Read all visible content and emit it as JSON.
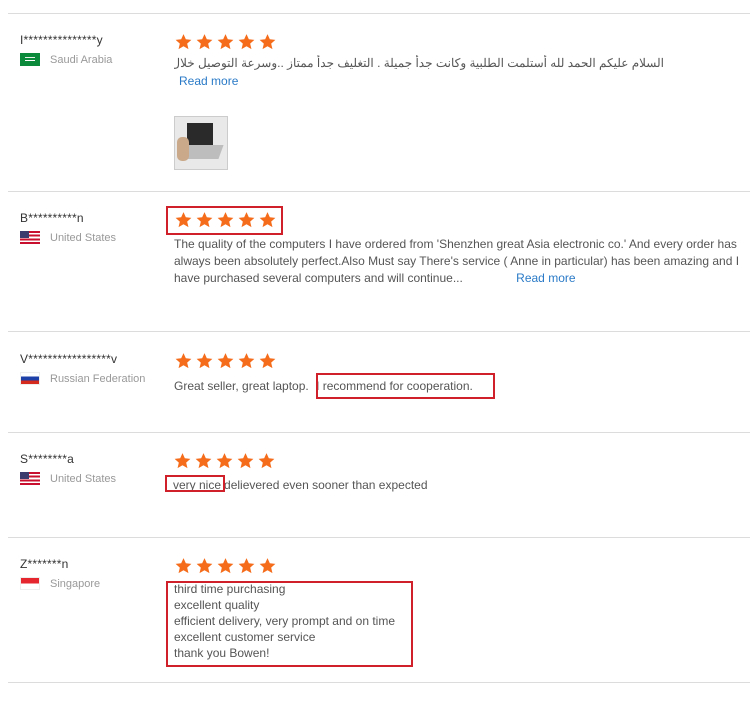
{
  "colors": {
    "star": "#f56c1b",
    "link": "#2a7ac7",
    "highlight": "#d0202a"
  },
  "reviews": [
    {
      "name": "I***************y",
      "country": "Saudi Arabia",
      "flag_icon": "saudi-arabia-flag-icon",
      "rating": 5,
      "text": "السلام عليكم الحمد لله أستلمت الطلبية وكانت جدأ جميلة . التغليف جدأ ممتاز ..وسرعة التوصيل خلال اسبوع..الجهاز ويند...",
      "read_more": "Read more",
      "has_photo": true
    },
    {
      "name": "B**********n",
      "country": "United States",
      "flag_icon": "united-states-flag-icon",
      "rating": 5,
      "text": "The quality of the computers I have ordered from 'Shenzhen great Asia electronic co.' And every order has always been absolutely perfect.Also Must say There's service ( Anne in particular) has been amazing and I have purchased several computers and will continue...",
      "read_more": "Read more"
    },
    {
      "name": "V*****************v",
      "country": "Russian Federation",
      "flag_icon": "russia-flag-icon",
      "rating": 5,
      "text_a": "Great seller, great laptop.",
      "text_b": "I recommend for cooperation."
    },
    {
      "name": "S********a",
      "country": "United States",
      "flag_icon": "united-states-flag-icon",
      "rating": 5,
      "text_a": "very nice",
      "text_b": "delievered even sooner than expected"
    },
    {
      "name": "Z*******n",
      "country": "Singapore",
      "flag_icon": "singapore-flag-icon",
      "rating": 5,
      "lines": [
        "third time purchasing",
        "excellent quality",
        "efficient delivery, very prompt and on time",
        "excellent customer service",
        "thank you Bowen!"
      ]
    }
  ]
}
